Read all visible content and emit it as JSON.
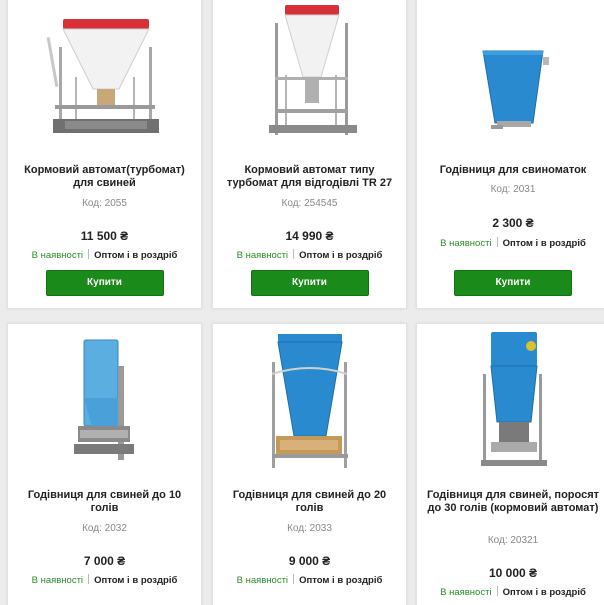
{
  "products": [
    {
      "name": "Кормовий автомат(турбомат) для свиней",
      "code": "Код: 2055",
      "price": "11 500 ₴",
      "availability": "В наявності",
      "sale_type": "Оптом і в роздріб",
      "buy_label": "Купити"
    },
    {
      "name": "Кормовий автомат типу турбомат для відгодівлі TR 27",
      "code": "Код: 254545",
      "price": "14 990 ₴",
      "availability": "В наявності",
      "sale_type": "Оптом і в роздріб",
      "buy_label": "Купити"
    },
    {
      "name": "Годівниця для свиноматок",
      "code": "Код: 2031",
      "price": "2 300 ₴",
      "availability": "В наявності",
      "sale_type": "Оптом і в роздріб",
      "buy_label": "Купити"
    },
    {
      "name": "Годівниця для свиней до 10 голів",
      "code": "Код: 2032",
      "price": "7 000 ₴",
      "availability": "В наявності",
      "sale_type": "Оптом і в роздріб"
    },
    {
      "name": "Годівниця для свиней до 20 голів",
      "code": "Код: 2033",
      "price": "9 000 ₴",
      "availability": "В наявності",
      "sale_type": "Оптом і в роздріб"
    },
    {
      "name": "Годівниця для свиней, поросят до 30 голів (кормовий автомат)",
      "code": "Код: 20321",
      "price": "10 000 ₴",
      "availability": "В наявності",
      "sale_type": "Оптом і в роздріб"
    }
  ],
  "colors": {
    "buy_button": "#1a8a1a",
    "in_stock": "#2a8a2a",
    "feeder_blue": "#2a8ad0",
    "hopper_red": "#d9303a"
  }
}
